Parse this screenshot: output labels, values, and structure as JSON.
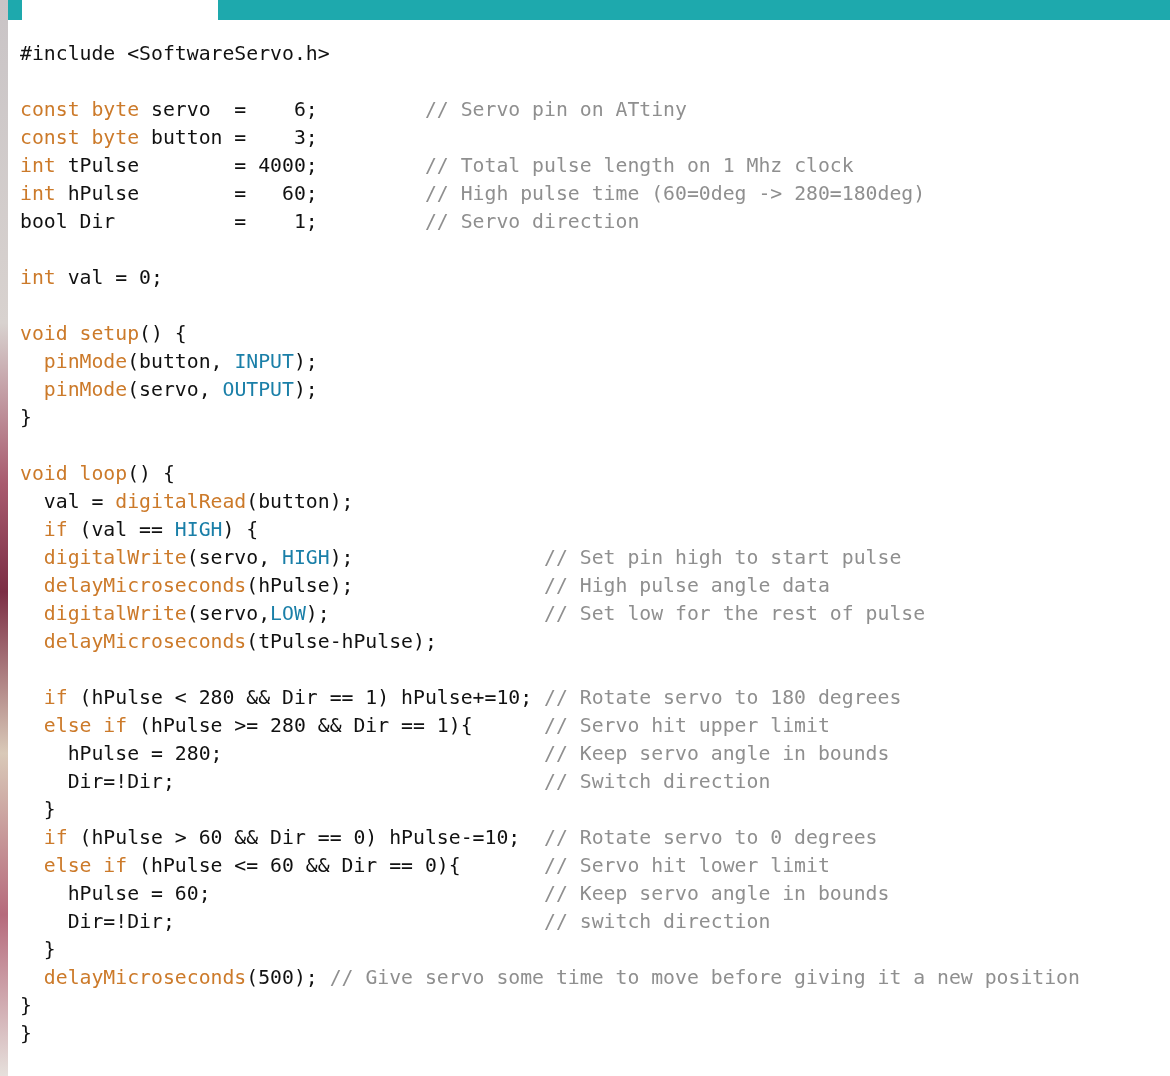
{
  "editor": {
    "tab": {
      "selected": true
    },
    "lines": [
      {
        "kind": "code",
        "tokens": [
          {
            "kind": "text",
            "text": "#include <SoftwareServo.h>"
          }
        ]
      },
      {
        "kind": "blank"
      },
      {
        "kind": "code",
        "tokens": [
          {
            "kind": "keyword",
            "text": "const byte"
          },
          {
            "kind": "text",
            "text": " servo  =    6;         "
          },
          {
            "kind": "comment",
            "text": "// Servo pin on ATtiny"
          }
        ]
      },
      {
        "kind": "code",
        "tokens": [
          {
            "kind": "keyword",
            "text": "const byte"
          },
          {
            "kind": "text",
            "text": " button =    3;"
          }
        ]
      },
      {
        "kind": "code",
        "tokens": [
          {
            "kind": "keyword",
            "text": "int"
          },
          {
            "kind": "text",
            "text": " tPulse        = 4000;         "
          },
          {
            "kind": "comment",
            "text": "// Total pulse length on 1 Mhz clock"
          }
        ]
      },
      {
        "kind": "code",
        "tokens": [
          {
            "kind": "keyword",
            "text": "int"
          },
          {
            "kind": "text",
            "text": " hPulse        =   60;         "
          },
          {
            "kind": "comment",
            "text": "// High pulse time (60=0deg -> 280=180deg)"
          }
        ]
      },
      {
        "kind": "code",
        "tokens": [
          {
            "kind": "text",
            "text": "bool Dir          =    1;         "
          },
          {
            "kind": "comment",
            "text": "// Servo direction"
          }
        ]
      },
      {
        "kind": "blank"
      },
      {
        "kind": "code",
        "tokens": [
          {
            "kind": "keyword",
            "text": "int"
          },
          {
            "kind": "text",
            "text": " val = 0;"
          }
        ]
      },
      {
        "kind": "blank"
      },
      {
        "kind": "code",
        "tokens": [
          {
            "kind": "keyword",
            "text": "void setup"
          },
          {
            "kind": "text",
            "text": "() {"
          }
        ]
      },
      {
        "kind": "code",
        "tokens": [
          {
            "kind": "keyword",
            "text": "  pinMode"
          },
          {
            "kind": "text",
            "text": "(button, "
          },
          {
            "kind": "constant",
            "text": "INPUT"
          },
          {
            "kind": "text",
            "text": ");"
          }
        ]
      },
      {
        "kind": "code",
        "tokens": [
          {
            "kind": "keyword",
            "text": "  pinMode"
          },
          {
            "kind": "text",
            "text": "(servo, "
          },
          {
            "kind": "constant",
            "text": "OUTPUT"
          },
          {
            "kind": "text",
            "text": ");"
          }
        ]
      },
      {
        "kind": "code",
        "tokens": [
          {
            "kind": "text",
            "text": "}"
          }
        ]
      },
      {
        "kind": "blank"
      },
      {
        "kind": "code",
        "tokens": [
          {
            "kind": "keyword",
            "text": "void loop"
          },
          {
            "kind": "text",
            "text": "() {"
          }
        ]
      },
      {
        "kind": "code",
        "tokens": [
          {
            "kind": "text",
            "text": "  val = "
          },
          {
            "kind": "keyword",
            "text": "digitalRead"
          },
          {
            "kind": "text",
            "text": "(button);"
          }
        ]
      },
      {
        "kind": "code",
        "tokens": [
          {
            "kind": "keyword",
            "text": "  if"
          },
          {
            "kind": "text",
            "text": " (val == "
          },
          {
            "kind": "constant",
            "text": "HIGH"
          },
          {
            "kind": "text",
            "text": ") {"
          }
        ]
      },
      {
        "kind": "code",
        "tokens": [
          {
            "kind": "keyword",
            "text": "  digitalWrite"
          },
          {
            "kind": "text",
            "text": "(servo, "
          },
          {
            "kind": "constant",
            "text": "HIGH"
          },
          {
            "kind": "text",
            "text": ");                "
          },
          {
            "kind": "comment",
            "text": "// Set pin high to start pulse"
          }
        ]
      },
      {
        "kind": "code",
        "tokens": [
          {
            "kind": "keyword",
            "text": "  delayMicroseconds"
          },
          {
            "kind": "text",
            "text": "(hPulse);                "
          },
          {
            "kind": "comment",
            "text": "// High pulse angle data"
          }
        ]
      },
      {
        "kind": "code",
        "tokens": [
          {
            "kind": "keyword",
            "text": "  digitalWrite"
          },
          {
            "kind": "text",
            "text": "(servo,"
          },
          {
            "kind": "constant",
            "text": "LOW"
          },
          {
            "kind": "text",
            "text": ");                  "
          },
          {
            "kind": "comment",
            "text": "// Set low for the rest of pulse"
          }
        ]
      },
      {
        "kind": "code",
        "tokens": [
          {
            "kind": "keyword",
            "text": "  delayMicroseconds"
          },
          {
            "kind": "text",
            "text": "(tPulse-hPulse);"
          }
        ]
      },
      {
        "kind": "blank"
      },
      {
        "kind": "code",
        "tokens": [
          {
            "kind": "keyword",
            "text": "  if"
          },
          {
            "kind": "text",
            "text": " (hPulse < 280 && Dir == 1) hPulse+=10; "
          },
          {
            "kind": "comment",
            "text": "// Rotate servo to 180 degrees"
          }
        ]
      },
      {
        "kind": "code",
        "tokens": [
          {
            "kind": "keyword",
            "text": "  else if"
          },
          {
            "kind": "text",
            "text": " (hPulse >= 280 && Dir == 1){      "
          },
          {
            "kind": "comment",
            "text": "// Servo hit upper limit"
          }
        ]
      },
      {
        "kind": "code",
        "tokens": [
          {
            "kind": "text",
            "text": "    hPulse = 280;                           "
          },
          {
            "kind": "comment",
            "text": "// Keep servo angle in bounds"
          }
        ]
      },
      {
        "kind": "code",
        "tokens": [
          {
            "kind": "text",
            "text": "    Dir=!Dir;                               "
          },
          {
            "kind": "comment",
            "text": "// Switch direction"
          }
        ]
      },
      {
        "kind": "code",
        "tokens": [
          {
            "kind": "text",
            "text": "  }"
          }
        ]
      },
      {
        "kind": "code",
        "tokens": [
          {
            "kind": "keyword",
            "text": "  if"
          },
          {
            "kind": "text",
            "text": " (hPulse > 60 && Dir == 0) hPulse-=10;  "
          },
          {
            "kind": "comment",
            "text": "// Rotate servo to 0 degrees"
          }
        ]
      },
      {
        "kind": "code",
        "tokens": [
          {
            "kind": "keyword",
            "text": "  else if"
          },
          {
            "kind": "text",
            "text": " (hPulse <= 60 && Dir == 0){       "
          },
          {
            "kind": "comment",
            "text": "// Servo hit lower limit"
          }
        ]
      },
      {
        "kind": "code",
        "tokens": [
          {
            "kind": "text",
            "text": "    hPulse = 60;                            "
          },
          {
            "kind": "comment",
            "text": "// Keep servo angle in bounds"
          }
        ]
      },
      {
        "kind": "code",
        "tokens": [
          {
            "kind": "text",
            "text": "    Dir=!Dir;                               "
          },
          {
            "kind": "comment",
            "text": "// switch direction"
          }
        ]
      },
      {
        "kind": "code",
        "tokens": [
          {
            "kind": "text",
            "text": "  }"
          }
        ]
      },
      {
        "kind": "code",
        "tokens": [
          {
            "kind": "keyword",
            "text": "  delayMicroseconds"
          },
          {
            "kind": "text",
            "text": "(500); "
          },
          {
            "kind": "comment",
            "text": "// Give servo some time to move before giving it a new position"
          }
        ]
      },
      {
        "kind": "code",
        "tokens": [
          {
            "kind": "text",
            "text": "}"
          }
        ]
      },
      {
        "kind": "code",
        "tokens": [
          {
            "kind": "text",
            "text": "}"
          }
        ]
      }
    ]
  }
}
